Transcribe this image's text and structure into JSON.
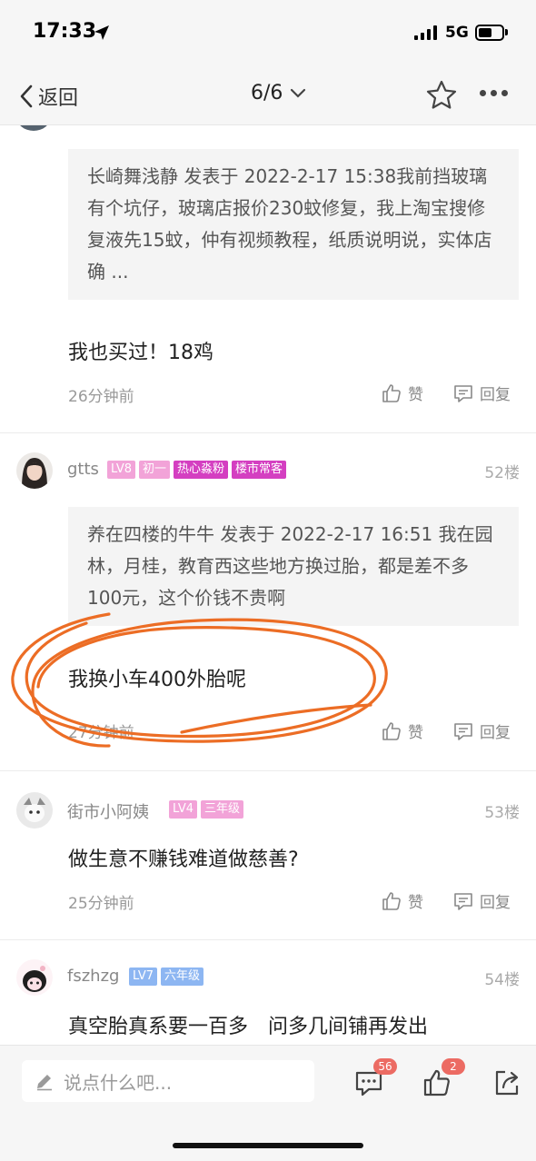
{
  "status_bar": {
    "time": "17:33",
    "network": "5G"
  },
  "nav": {
    "back_label": "返回",
    "page_indicator": "6/6"
  },
  "posts": [
    {
      "quote": "长崎舞浅静 发表于 2022-2-17 15:38我前挡玻璃有个坑仔，玻璃店报价230蚊修复，我上淘宝搜修复液先15蚊，仲有视频教程，纸质说明说，实体店确 ...",
      "text": "我也买过！18鸡",
      "time": "26分钟前",
      "like_label": "赞",
      "reply_label": "回复"
    },
    {
      "username": "gtts",
      "badges": [
        "LV8",
        "初一",
        "热心淼粉",
        "楼市常客"
      ],
      "floor": "52楼",
      "quote": "养在四楼的牛牛 发表于 2022-2-17 16:51 我在园林，月桂，教育西这些地方换过胎，都是差不多100元，这个价钱不贵啊",
      "text": "我换小车400外胎呢",
      "time": "27分钟前",
      "like_label": "赞",
      "reply_label": "回复"
    },
    {
      "username": "街市小阿姨",
      "badges": [
        "LV4",
        "三年级"
      ],
      "floor": "53楼",
      "text": "做生意不赚钱难道做慈善?",
      "time": "25分钟前",
      "like_label": "赞",
      "reply_label": "回复"
    },
    {
      "username": "fszhzg",
      "badges": [
        "LV7",
        "六年级"
      ],
      "floor": "54楼",
      "text": "真空胎真系要一百多　问多几间铺再发出"
    }
  ],
  "bottom_bar": {
    "input_placeholder": "说点什么吧...",
    "comment_count": "56",
    "like_count": "2"
  },
  "colors": {
    "annotation_circle": "#ec6d25",
    "badge_pink": "#f2a3d8",
    "badge_magenta": "#d43fc1",
    "badge_blue": "#8db6f2",
    "count_badge": "#ec6b63"
  },
  "icons": [
    "location-arrow-icon",
    "back-chevron-icon",
    "dropdown-chevron-icon",
    "star-icon",
    "more-icon",
    "thumbs-up-icon",
    "comment-icon",
    "edit-pencil-icon",
    "share-icon"
  ]
}
